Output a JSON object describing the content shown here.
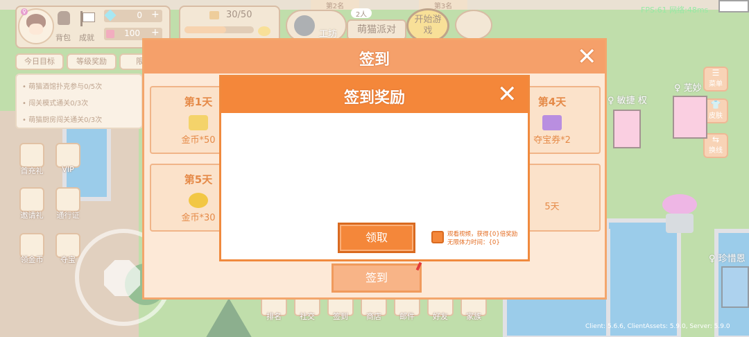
{
  "hud": {
    "bag_label": "背包",
    "achievement_label": "成就",
    "diamonds": "0",
    "coins": "100",
    "plus": "+",
    "energy": "30/50",
    "tab_today": "今日目标",
    "tab_level": "等级奖励",
    "tab_partial": "限",
    "goals": [
      "萌猫酒馆扑克参与0/5次",
      "闯关模式通关0/3次",
      "萌猫厨房闯关通关0/3次"
    ]
  },
  "top": {
    "rank2": "第2名",
    "rank3": "第3名",
    "workshop": "工坊",
    "party_count": "2人",
    "party": "萌猫派对",
    "start_game": "开始游戏"
  },
  "side": {
    "first_charge": "首充礼",
    "vip": "VIP",
    "invite": "邀请礼",
    "pass": "通行证",
    "coins": "领金币",
    "treasure": "夺宝"
  },
  "bottom": [
    "排名",
    "社交",
    "签到",
    "商店",
    "邮件",
    "好友",
    "家族"
  ],
  "right": {
    "menu": "菜单",
    "skin": "皮肤",
    "switch_line": "换线"
  },
  "players": {
    "p1": "敏捷",
    "p1_suffix": "权",
    "p2": "芜妙",
    "p3": "珍惜恩"
  },
  "status": {
    "fps": "FPS:61 网络:48ms",
    "version": "Client: 5.6.6, ClientAssets: 5.9.0, Server: 5.9.0"
  },
  "signin": {
    "title": "签到",
    "close": "✕",
    "days": [
      {
        "day": "第1天",
        "reward": "金币*50"
      },
      {
        "day": "第4天",
        "reward": "夺宝券*2"
      },
      {
        "day": "第5天",
        "reward": "金币*30"
      },
      {
        "day": "",
        "reward": "5天"
      }
    ],
    "sign_button": "签到"
  },
  "reward_popup": {
    "title": "签到奖励",
    "close": "✕",
    "claim_button": "领取",
    "ad_line1": "观看视频，获得{0}倍奖励",
    "ad_line2": "无限体力时间：{0}"
  },
  "colors": {
    "accent": "#f4873a",
    "dialog_bg": "#fde9d7",
    "title_text": "#ffffff"
  }
}
